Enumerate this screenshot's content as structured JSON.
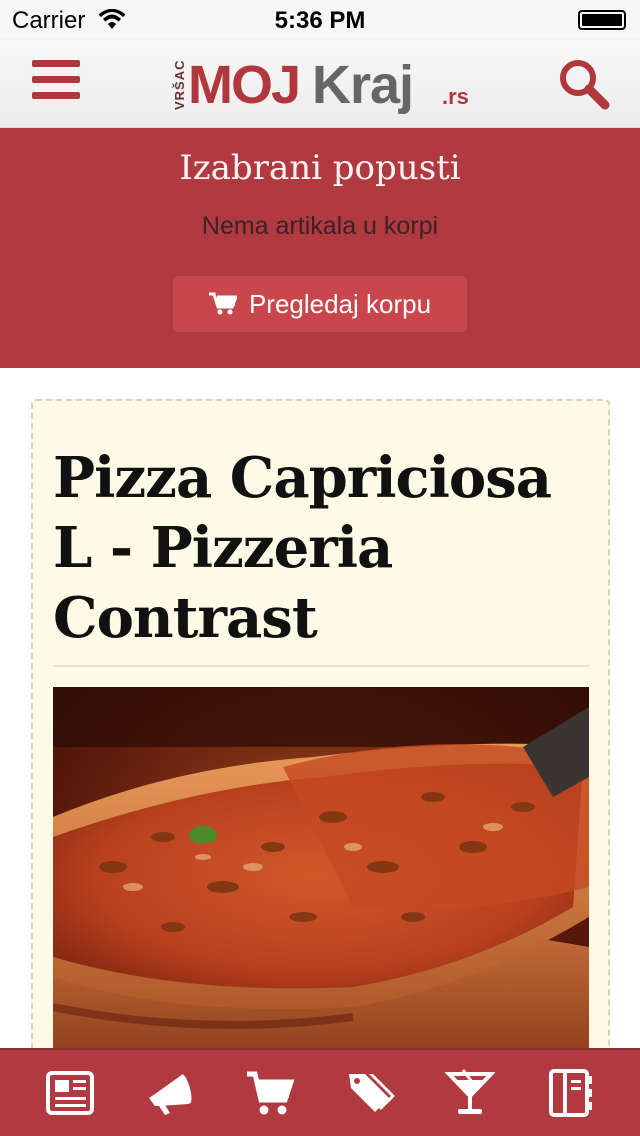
{
  "status_bar": {
    "carrier": "Carrier",
    "time": "5:36 PM"
  },
  "header": {
    "logo": {
      "city": "VRŠAC",
      "part1": "MOJ",
      "part2": "Kraj",
      "tld": ".rs"
    },
    "menu_icon": "hamburger-icon",
    "search_icon": "search-icon"
  },
  "cart_banner": {
    "title": "Izabrani popusti",
    "empty_message": "Nema artikala u korpi",
    "button_label": "Pregledaj korpu",
    "button_icon": "cart-icon"
  },
  "deal": {
    "title": "Pizza Capriciosa L - Pizzeria Contrast",
    "image_alt": "pizza"
  },
  "bottom_nav": {
    "items": [
      {
        "icon": "newspaper-icon"
      },
      {
        "icon": "megaphone-icon"
      },
      {
        "icon": "shopping-cart-icon"
      },
      {
        "icon": "tags-icon"
      },
      {
        "icon": "cocktail-icon"
      },
      {
        "icon": "notebook-icon"
      }
    ]
  },
  "colors": {
    "brand_red": "#b03a3f",
    "button_red": "#c9474c",
    "card_bg": "#fdfae6"
  }
}
